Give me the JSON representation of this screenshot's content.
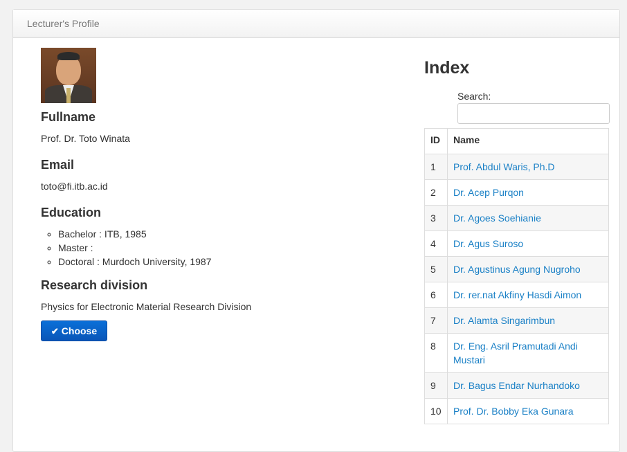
{
  "panel": {
    "title": "Lecturer's Profile"
  },
  "profile": {
    "photo_alt": "Lecturer photo",
    "fullname_label": "Fullname",
    "fullname": "Prof. Dr. Toto Winata",
    "email_label": "Email",
    "email": "toto@fi.itb.ac.id",
    "education_label": "Education",
    "education": [
      "Bachelor : ITB, 1985",
      "Master :",
      "Doctoral : Murdoch University, 1987"
    ],
    "research_label": "Research division",
    "research": "Physics for Electronic Material Research Division",
    "choose_label": "Choose",
    "choose_icon": "check-icon"
  },
  "index": {
    "title": "Index",
    "search_label": "Search:",
    "search_value": "",
    "columns": [
      "ID",
      "Name"
    ],
    "rows": [
      {
        "id": "1",
        "name": "Prof. Abdul Waris, Ph.D"
      },
      {
        "id": "2",
        "name": "Dr. Acep Purqon"
      },
      {
        "id": "3",
        "name": "Dr. Agoes Soehianie"
      },
      {
        "id": "4",
        "name": "Dr. Agus Suroso"
      },
      {
        "id": "5",
        "name": "Dr. Agustinus Agung Nugroho"
      },
      {
        "id": "6",
        "name": "Dr. rer.nat Akfiny Hasdi Aimon"
      },
      {
        "id": "7",
        "name": "Dr. Alamta Singarimbun"
      },
      {
        "id": "8",
        "name": "Dr. Eng. Asril Pramutadi Andi Mustari"
      },
      {
        "id": "9",
        "name": "Dr. Bagus Endar Nurhandoko"
      },
      {
        "id": "10",
        "name": "Prof. Dr. Bobby Eka Gunara"
      }
    ]
  }
}
